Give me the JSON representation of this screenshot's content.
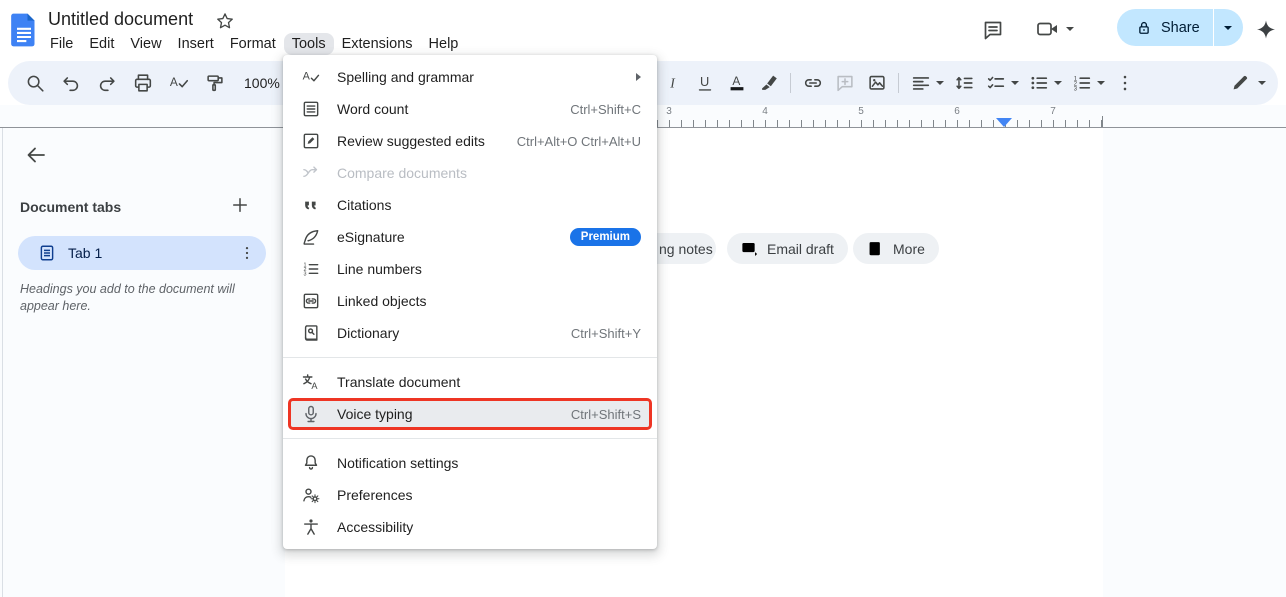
{
  "header": {
    "title": "Untitled document",
    "menu_items": [
      "File",
      "Edit",
      "View",
      "Insert",
      "Format",
      "Tools",
      "Extensions",
      "Help"
    ],
    "share_label": "Share"
  },
  "toolbar": {
    "zoom_value": "100%"
  },
  "tools_menu": {
    "items": [
      {
        "label": "Spelling and grammar",
        "icon": "spellcheck-icon",
        "has_submenu": true
      },
      {
        "label": "Word count",
        "shortcut": "Ctrl+Shift+C",
        "icon": "word-count-icon"
      },
      {
        "label": "Review suggested edits",
        "shortcut": "Ctrl+Alt+O Ctrl+Alt+U",
        "icon": "review-edits-icon"
      },
      {
        "label": "Compare documents",
        "icon": "compare-documents-icon",
        "disabled": true
      },
      {
        "label": "Citations",
        "icon": "citations-icon"
      },
      {
        "label": "eSignature",
        "icon": "esignature-icon",
        "badge": "Premium"
      },
      {
        "label": "Line numbers",
        "icon": "line-numbers-icon"
      },
      {
        "label": "Linked objects",
        "icon": "linked-objects-icon"
      },
      {
        "label": "Dictionary",
        "shortcut": "Ctrl+Shift+Y",
        "icon": "dictionary-icon"
      },
      {
        "divider": true
      },
      {
        "label": "Translate document",
        "icon": "translate-icon"
      },
      {
        "label": "Voice typing",
        "shortcut": "Ctrl+Shift+S",
        "icon": "microphone-icon",
        "highlighted": true
      },
      {
        "divider": true
      },
      {
        "label": "Notification settings",
        "icon": "bell-icon"
      },
      {
        "label": "Preferences",
        "icon": "preferences-icon"
      },
      {
        "label": "Accessibility",
        "icon": "accessibility-icon"
      }
    ]
  },
  "sidebar": {
    "section_title": "Document tabs",
    "tab_label": "Tab 1",
    "hint": "Headings you add to the document will appear here."
  },
  "ruler": {
    "numbers": [
      "3",
      "4",
      "5",
      "6",
      "7"
    ]
  },
  "doc": {
    "chips": [
      {
        "label": "ng notes"
      },
      {
        "label": "Email draft",
        "icon": "email-icon"
      },
      {
        "label": "More",
        "icon": "doc-plus-icon"
      }
    ]
  },
  "colors": {
    "toolbar_bg": "#edf2fa",
    "share_pill": "#c2e7ff",
    "tab_pill": "#d3e3fd",
    "premium_badge": "#1a73e8",
    "highlight_red": "#ee3524",
    "ruler_marker": "#4285f4"
  }
}
